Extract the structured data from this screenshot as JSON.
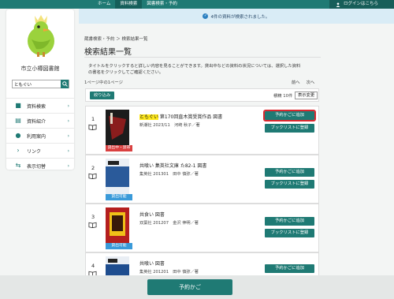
{
  "topnav": {
    "items": [
      "ホーム",
      "資料検索",
      "図書検索・予約"
    ],
    "login": "ログインはこちら"
  },
  "notice": "4件の資料が検索されました。",
  "sidebar": {
    "library_name": "市立小樽図書館",
    "search_value": "ともぐい",
    "menu": [
      {
        "label": "資料検索",
        "icon": "book-search-icon"
      },
      {
        "label": "資料紹介",
        "icon": "book-open-icon"
      },
      {
        "label": "利用案内",
        "icon": "person-icon"
      },
      {
        "label": "リンク",
        "icon": "chevron-link-icon"
      },
      {
        "label": "表示切替",
        "icon": "swap-icon"
      }
    ]
  },
  "main": {
    "breadcrumb": "蔵書検索・予約 ＞ 検索結果一覧",
    "title": "検索結果一覧",
    "description_line1": "タイトルをクリックすると詳しい内容を見ることができます。貸出中などの資料の状況については、選択した資料",
    "description_line2": "の書名をクリックしてご確認ください。",
    "page_count": "1ページ中の1ページ",
    "prev": "前へ",
    "next": "次へ",
    "filter": "絞り込み",
    "per_page": "積精 10件",
    "change_view": "表示変更"
  },
  "results": [
    {
      "num": "1",
      "title_hl": "ともぐい",
      "title_rest": " 第170回直木賞受賞作品 図書",
      "meta": "新潮社 2023/11　河崎 秋子／著",
      "status": "貸出中・禁帯",
      "status_color": "#d94040"
    },
    {
      "num": "2",
      "title_hl": "",
      "title_rest": "共喰い 集英社文庫 た82-1 図書",
      "meta": "集英社 201301　田中 慎弥／著",
      "status": "貸出可能",
      "status_color": "#3a9ad9"
    },
    {
      "num": "3",
      "title_hl": "",
      "title_rest": "共食い 図書",
      "meta": "双葉社 201207　金沢 伸明／著",
      "status": "貸出可能",
      "status_color": "#3a9ad9"
    },
    {
      "num": "4",
      "title_hl": "",
      "title_rest": "共喰い 図書",
      "meta": "集英社 201201　田中 慎弥／著",
      "status": "",
      "status_color": ""
    }
  ],
  "buttons": {
    "add_to_cart": "予約かごに追加",
    "add_to_booklist": "ブックリストに登録"
  },
  "cart": "予約かご"
}
